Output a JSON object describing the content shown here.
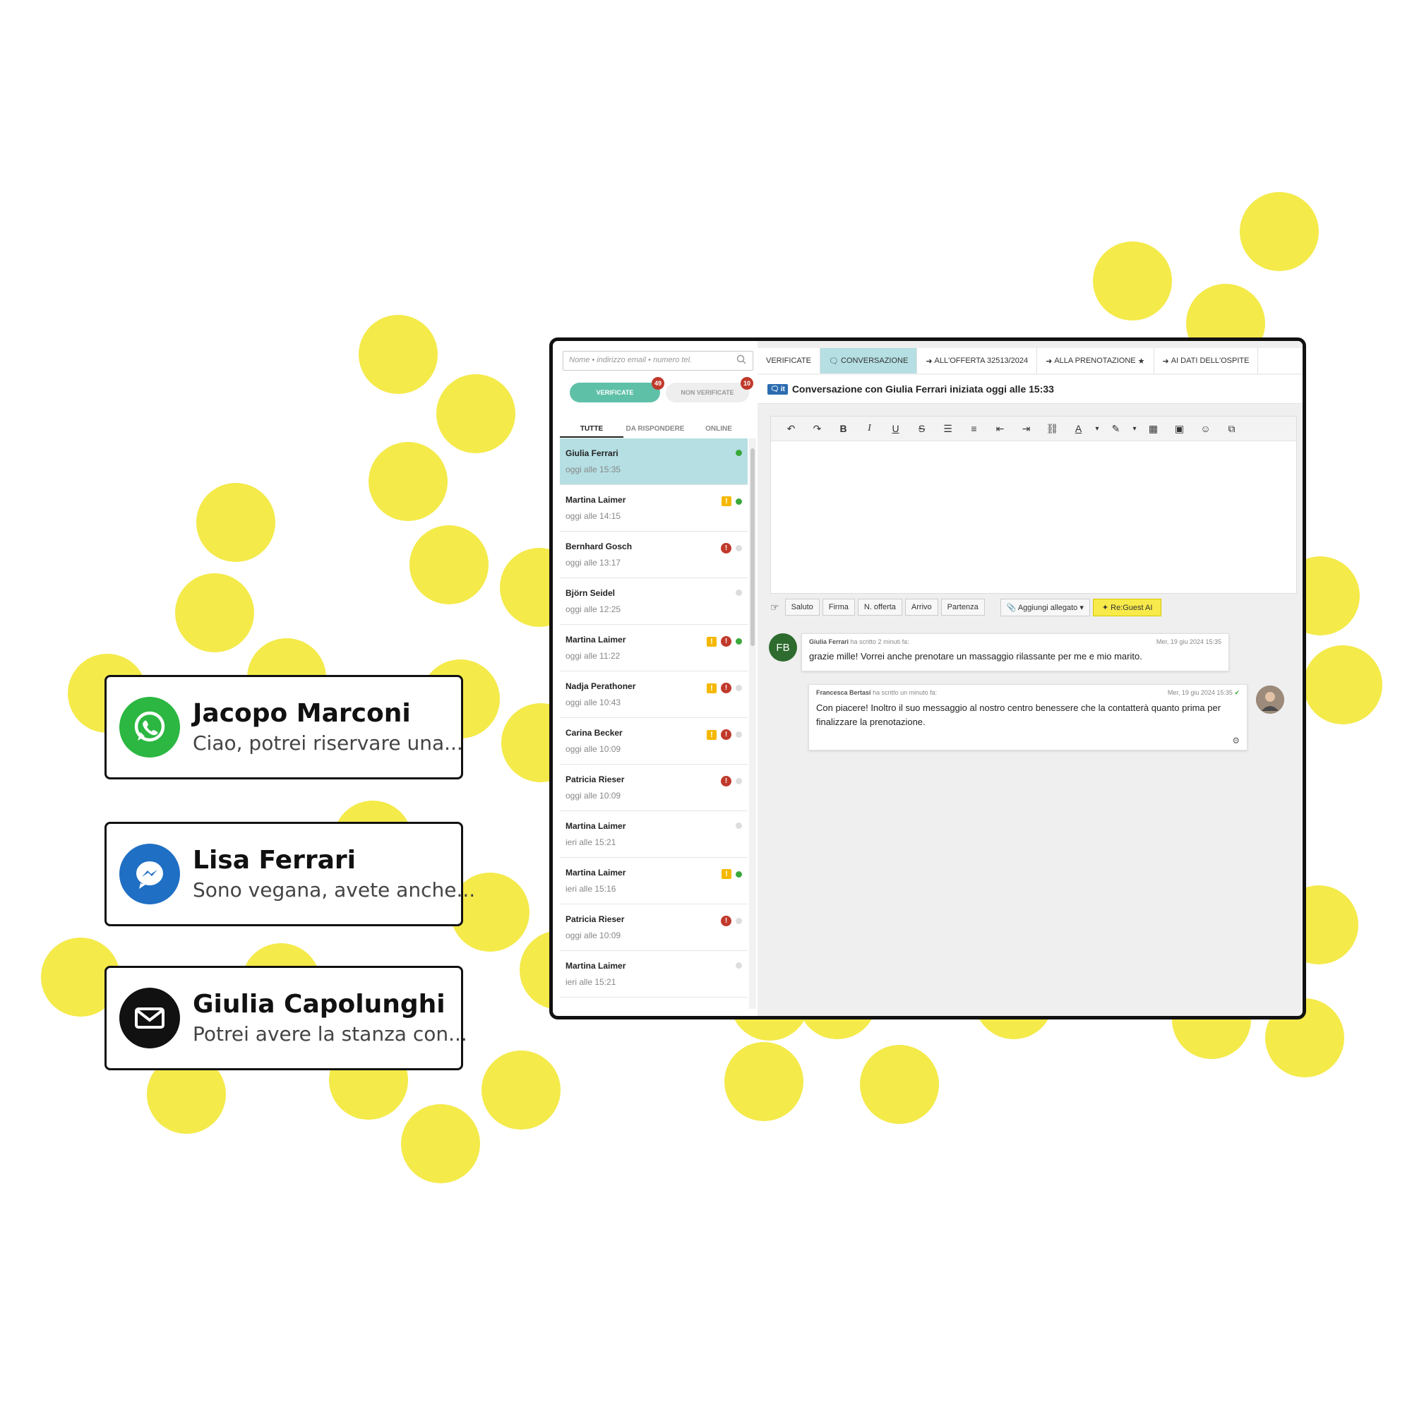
{
  "cards": [
    {
      "name": "Jacopo Marconi",
      "message": "Ciao, potrei riservare una...",
      "icon": "whatsapp-icon",
      "color": "#2bb741"
    },
    {
      "name": "Lisa Ferrari",
      "message": "Sono vegana, avete anche...",
      "icon": "messenger-icon",
      "color": "#1f6fc4"
    },
    {
      "name": "Giulia Capolunghi",
      "message": "Potrei avere la stanza con...",
      "icon": "mail-icon",
      "color": "#111111"
    }
  ],
  "app": {
    "search_placeholder": "Nome • indirizzo email • numero tel.",
    "filter_verified": "VERIFICATE",
    "filter_verified_count": "49",
    "filter_unverified": "NON VERIFICATE",
    "filter_unverified_count": "10",
    "tabs": [
      "TUTTE",
      "DA RISPONDERE",
      "ONLINE"
    ],
    "conversations": [
      {
        "name": "Giulia Ferrari",
        "time": "oggi alle 15:35",
        "warn": false,
        "alert": false,
        "online": true
      },
      {
        "name": "Martina Laimer",
        "time": "oggi alle 14:15",
        "warn": true,
        "alert": false,
        "online": true
      },
      {
        "name": "Bernhard Gosch",
        "time": "oggi alle 13:17",
        "warn": false,
        "alert": true,
        "online": false
      },
      {
        "name": "Björn Seidel",
        "time": "oggi alle 12:25",
        "warn": false,
        "alert": false,
        "online": false
      },
      {
        "name": "Martina Laimer",
        "time": "oggi alle 11:22",
        "warn": true,
        "alert": true,
        "online": true
      },
      {
        "name": "Nadja Perathoner",
        "time": "oggi alle 10:43",
        "warn": true,
        "alert": true,
        "online": false
      },
      {
        "name": "Carina Becker",
        "time": "oggi alle 10:09",
        "warn": true,
        "alert": true,
        "online": false
      },
      {
        "name": "Patricia Rieser",
        "time": "oggi alle 10:09",
        "warn": false,
        "alert": true,
        "online": false
      },
      {
        "name": "Martina Laimer",
        "time": "ieri alle 15:21",
        "warn": false,
        "alert": false,
        "online": false
      },
      {
        "name": "Martina Laimer",
        "time": "ieri alle 15:16",
        "warn": true,
        "alert": false,
        "online": true
      },
      {
        "name": "Patricia Rieser",
        "time": "oggi alle 10:09",
        "warn": false,
        "alert": true,
        "online": false
      },
      {
        "name": "Martina Laimer",
        "time": "ieri alle 15:21",
        "warn": false,
        "alert": false,
        "online": false
      }
    ],
    "topbar": {
      "verified": "VERIFICATE",
      "conversation": "CONVERSAZIONE",
      "offer": "ALL'OFFERTA 32513/2024",
      "booking": "ALLA PRENOTAZIONE",
      "guest": "AI DATI DELL'OSPITE"
    },
    "lang_code": "it",
    "conversation_title": "Conversazione con Giulia Ferrari iniziata oggi alle 15:33",
    "snippets": [
      "Saluto",
      "Firma",
      "N. offerta",
      "Arrivo",
      "Partenza"
    ],
    "attach_label": "Aggiungi allegato",
    "ai_label": "Re:Guest AI",
    "messages": [
      {
        "initials": "FB",
        "author": "Giulia Ferrari",
        "action": "ha scritto 2 minuti fa:",
        "date": "Mer, 19 giu 2024 15:35",
        "text": "grazie mille! Vorrei anche prenotare un massaggio rilassante per me e mio marito."
      },
      {
        "author": "Francesca Bertasi",
        "action": "ha scritto un minuto fa:",
        "date": "Mer, 19 giu 2024 15:35",
        "text": "Con piacere! Inoltro il suo messaggio al nostro centro benessere che la contatterà quanto prima per finalizzare la prenotazione."
      }
    ]
  }
}
